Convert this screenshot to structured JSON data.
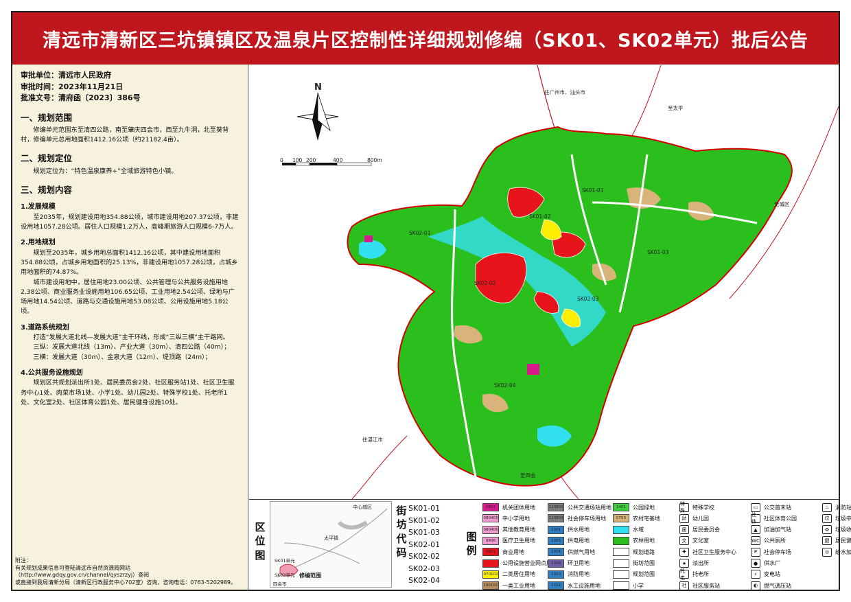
{
  "title": "清远市清新区三坑镇镇区及温泉片区控制性详细规划修编（SK01、SK02单元）批后公告",
  "approval": {
    "unit": "审批单位：清远市人民政府",
    "time": "审批时间：2023年11月21日",
    "doc": "批准文号：清府函〔2023〕386号"
  },
  "sections": {
    "scope_title": "一、规划范围",
    "scope_text": "修编单元范围东至清四公路，南至肇庆四会市，西至九牛洞，北至葵背村，修编单元总用地面积1412.16公顷（约21182.4亩）。",
    "position_title": "二、规划定位",
    "position_text": "规划定位为：“特色温泉康养+”全域旅游特色小镇。",
    "content_title": "三、规划内容",
    "dev_title": "1.发展规模",
    "dev_text": "至2035年，规划建设用地354.88公顷，城市建设用地207.37公顷，非建设用地1057.28公顷。居住人口规模1.2万人，高峰期旅游人口规模6-7万人。",
    "land_title": "2.用地规划",
    "land_text1": "规划至2035年，城乡用地总面积1412.16公顷，其中建设用地面积354.88公顷，占城乡用地面积的25.13%，非建设用地1057.28公顷，占城乡用地面积的74.87%。",
    "land_text2": "城市建设用地中，居住用地23.00公顷、公共管理与公共服务设施用地2.38公顷、商业服务业设施用地106.65公顷、工业用地2.54公顷、绿地与广场用地14.54公顷、道路与交通设施用地53.08公顷、公用设施用地5.18公顷。",
    "road_title": "3.道路系统规划",
    "road_text1": "打造“发展大道北线—发展大道”主干环线，形成“三纵三横”主干路网。",
    "road_text2": "三纵：发展大道北线（13m）、产业大道（30m）、清四公路（40m）；",
    "road_text3": "三横：发展大道（30m）、金泉大道（12m）、堤顶路（24m）；",
    "pub_title": "4.公共服务设施规划",
    "pub_text": "规划区共规划派出所1处、居民委员会2处、社区服务站1处、社区卫生服务中心1处、肉菜市场1处、小学1处、幼儿园2处、特殊学校1处、托老所1处、文化室2处、社区体育公园1处、居民健身设施10处。"
  },
  "notes": {
    "title": "附注：",
    "line1": "有关规划成果信息可登陆清远市自然资源局网站（http://www.gdqy.gov.cn/channel/qyszrzyj）查阅",
    "line2": "或直接到我局清新分局（清新区行政服务中心702室）咨询，咨询电话：0763-5202989。"
  },
  "map": {
    "north": "N",
    "scale_labels": [
      "0",
      "100",
      "200",
      "400",
      "800m"
    ],
    "labels": {
      "to_guangzhou": "往广州市、汕头市",
      "to_taiping": "至太平",
      "to_chengqu": "至城区",
      "to_zhanjiang": "往湛江市",
      "to_sihui": "至四会",
      "sk0101": "SK01-01",
      "sk0102": "SK01-02",
      "sk0103": "SK01-03",
      "sk0201": "SK02-01",
      "sk0202": "SK02-02",
      "sk0203": "SK02-03",
      "sk0204": "SK02-04"
    }
  },
  "bottom": {
    "location_label": "区位图",
    "inset": {
      "center": "中心城区",
      "taiping": "太平镇",
      "sihui": "四会市",
      "area": "修编范围",
      "unit": "SK01单元",
      "unit2": "SK02单元"
    },
    "units_label": "街坊代码",
    "units": [
      "SK01-01",
      "SK01-02",
      "SK01-03",
      "SK02-01",
      "SK02-02",
      "SK02-03",
      "SK02-04"
    ],
    "legend_label": "图例"
  },
  "legend": [
    {
      "code": "0801",
      "label": "机关团体用地",
      "color": "#d81b8c"
    },
    {
      "code": "080403",
      "label": "中小学用地",
      "color": "#f29bd0"
    },
    {
      "code": "080405",
      "label": "其他教育用地",
      "color": "#f29bd0"
    },
    {
      "code": "0806",
      "label": "医疗卫生用地",
      "color": "#f29bd0"
    },
    {
      "code": "0901",
      "label": "商业用地",
      "color": "#e8141c"
    },
    {
      "code": "",
      "label": "公用设施营业网点用地",
      "color": "#e8141c"
    },
    {
      "code": "070102",
      "label": "二类居住用地",
      "color": "#ffee00"
    },
    {
      "code": "100101",
      "label": "一类工业用地",
      "color": "#b68d5c"
    },
    {
      "code": "120802",
      "label": "公共交通场站用地",
      "color": "#7f7f7f"
    },
    {
      "code": "120803",
      "label": "社会停车场用地",
      "color": "#7f7f7f"
    },
    {
      "code": "1301",
      "label": "供水用地",
      "color": "#2d7fc1"
    },
    {
      "code": "1303",
      "label": "供电用地",
      "color": "#2d7fc1"
    },
    {
      "code": "1304",
      "label": "供燃气用地",
      "color": "#2d7fc1"
    },
    {
      "code": "1309",
      "label": "环卫用地",
      "color": "#6f5fa8"
    },
    {
      "code": "1310",
      "label": "消防用地",
      "color": "#2d7fc1"
    },
    {
      "code": "1312",
      "label": "水工设施用地",
      "color": "#2d7fc1"
    },
    {
      "code": "1401",
      "label": "公园绿地",
      "color": "#3ecf3e"
    },
    {
      "code": "0703",
      "label": "农村宅基地",
      "color": "#d9b47a"
    },
    {
      "code": "",
      "label": "水域",
      "color": "#33e0f0"
    },
    {
      "code": "",
      "label": "农林用地",
      "color": "#2bbf1e"
    },
    {
      "code": "",
      "label": "规划道路",
      "color": "#ffffff"
    },
    {
      "code": "",
      "label": "街坊范围",
      "color": "#ffffff"
    },
    {
      "code": "",
      "label": "规划范围",
      "color": "#ffffff"
    },
    {
      "code": "",
      "label": "小学",
      "color": "#ffffff"
    }
  ],
  "facilities": [
    {
      "icon": "特殊",
      "label": "特殊学校"
    },
    {
      "icon": "幼",
      "label": "幼儿园"
    },
    {
      "icon": "居",
      "label": "居民委员会"
    },
    {
      "icon": "文",
      "label": "文化室"
    },
    {
      "icon": "✚",
      "label": "社区卫生服务中心"
    },
    {
      "icon": "★",
      "label": "派出所"
    },
    {
      "icon": "托老",
      "label": "托老所"
    },
    {
      "icon": "社",
      "label": "社区服务站"
    },
    {
      "icon": "▭",
      "label": "公交首末站"
    },
    {
      "icon": "社体",
      "label": "社区体育公园"
    },
    {
      "icon": "▲",
      "label": "加油加气站"
    },
    {
      "icon": "WC",
      "label": "公共厕所"
    },
    {
      "icon": "P",
      "label": "社会停车场"
    },
    {
      "icon": "●",
      "label": "供水厂"
    },
    {
      "icon": "⚡",
      "label": "变电站"
    },
    {
      "icon": "◐",
      "label": "燃气调压站"
    },
    {
      "icon": "♨",
      "label": "消防站"
    },
    {
      "icon": "垃",
      "label": "垃圾中转站"
    },
    {
      "icon": "♻",
      "label": "垃圾收集站"
    },
    {
      "icon": "健",
      "label": "居民健身场所"
    },
    {
      "icon": "◎",
      "label": "给水加压泵站"
    }
  ]
}
